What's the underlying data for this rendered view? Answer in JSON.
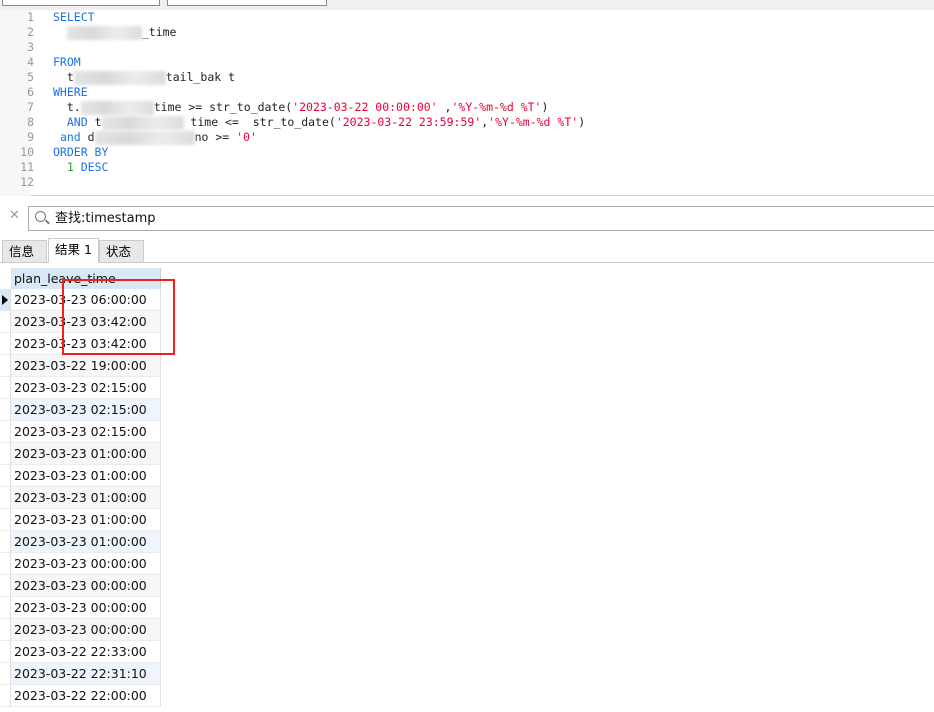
{
  "editor": {
    "line_numbers": [
      "1",
      "2",
      "3",
      "4",
      "5",
      "6",
      "7",
      "8",
      "9",
      "10",
      "11",
      "12"
    ],
    "l1": "SELECT",
    "l2": "_time",
    "l4": "FROM",
    "l5a": "t",
    "l5b": "tail_bak t",
    "l6": "WHERE",
    "l7a": "t.",
    "l7b": "time >= str_to_date(",
    "l7c": "'2023-03-22 00:00:00'",
    "l7d": " ,",
    "l7e": "'%Y-%m-%d %T'",
    "l7f": ")",
    "l8a": "AND",
    "l8b": " t",
    "l8c": " time <=  str_to_date(",
    "l8d": "'2023-03-22 23:59:59'",
    "l8e": ",",
    "l8f": "'%Y-%m-%d %T'",
    "l8g": ")",
    "l9a": "and",
    "l9b": " d",
    "l9c": "no >= ",
    "l9d": "'0'",
    "l10": "ORDER BY",
    "l11a": "1",
    "l11b": " DESC"
  },
  "search": {
    "value": "查找:timestamp"
  },
  "tabs": [
    "信息",
    "结果 1",
    "状态"
  ],
  "grid": {
    "column": "plan_leave_time",
    "rows": [
      "2023-03-23 06:00:00",
      "2023-03-23 03:42:00",
      "2023-03-23 03:42:00",
      "2023-03-22 19:00:00",
      "2023-03-23 02:15:00",
      "2023-03-23 02:15:00",
      "2023-03-23 02:15:00",
      "2023-03-23 01:00:00",
      "2023-03-23 01:00:00",
      "2023-03-23 01:00:00",
      "2023-03-23 01:00:00",
      "2023-03-23 01:00:00",
      "2023-03-23 00:00:00",
      "2023-03-23 00:00:00",
      "2023-03-23 00:00:00",
      "2023-03-23 00:00:00",
      "2023-03-22 22:33:00",
      "2023-03-22 22:31:10",
      "2023-03-22 22:00:00"
    ]
  },
  "colors": {
    "highlight": "#f02020",
    "keyword": "#1a73e8",
    "string": "#e8003a"
  }
}
